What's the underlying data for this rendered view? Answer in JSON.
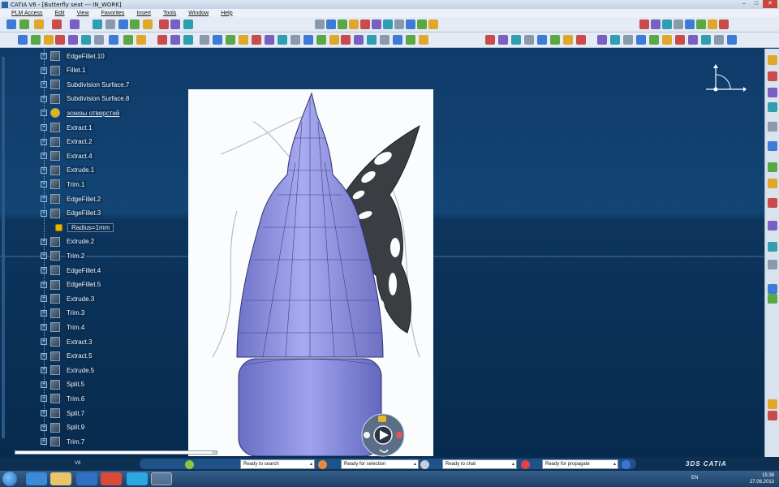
{
  "window": {
    "title": "CATIA V6 - [Butterfly seat --- IN_WORK]",
    "controls": [
      "–",
      "□",
      "✕"
    ]
  },
  "menu": [
    "PLM Access",
    "Edit",
    "View",
    "Favorites",
    "Insert",
    "Tools",
    "Window",
    "Help"
  ],
  "tree": {
    "nodes": [
      {
        "label": "EdgeFillet.10",
        "kind": "op"
      },
      {
        "label": "Fillet.1",
        "kind": "op"
      },
      {
        "label": "Subdivision Surface.7",
        "kind": "op"
      },
      {
        "label": "Subdivision Surface.8",
        "kind": "op"
      },
      {
        "label": "эскизы отверстий",
        "kind": "group"
      },
      {
        "label": "Extract.1",
        "kind": "op"
      },
      {
        "label": "Extract.2",
        "kind": "op"
      },
      {
        "label": "Extract.4",
        "kind": "op"
      },
      {
        "label": "Extrude.1",
        "kind": "op"
      },
      {
        "label": "Trim.1",
        "kind": "op"
      },
      {
        "label": "EdgeFillet.2",
        "kind": "op"
      },
      {
        "label": "EdgeFillet.3",
        "kind": "op"
      },
      {
        "label": "Radius=1mm",
        "kind": "param"
      },
      {
        "label": "Extrude.2",
        "kind": "op"
      },
      {
        "label": "Trim.2",
        "kind": "op"
      },
      {
        "label": "EdgeFillet.4",
        "kind": "op"
      },
      {
        "label": "EdgeFillet.5",
        "kind": "op"
      },
      {
        "label": "Extrude.3",
        "kind": "op"
      },
      {
        "label": "Trim.3",
        "kind": "op"
      },
      {
        "label": "Trim.4",
        "kind": "op"
      },
      {
        "label": "Extract.3",
        "kind": "op"
      },
      {
        "label": "Extract.5",
        "kind": "op"
      },
      {
        "label": "Extrude.5",
        "kind": "op"
      },
      {
        "label": "Split.5",
        "kind": "op"
      },
      {
        "label": "Trim.6",
        "kind": "op"
      },
      {
        "label": "Split.7",
        "kind": "op"
      },
      {
        "label": "Split.9",
        "kind": "op"
      },
      {
        "label": "Trim.7",
        "kind": "op"
      }
    ]
  },
  "status": {
    "app_badge": "V6",
    "fields": [
      "Ready to search",
      "Ready for selection",
      "Ready to chat",
      "Ready for propagate"
    ],
    "brand": "3DS CATIA"
  },
  "taskbar": {
    "lang": "EN",
    "time": "15:38",
    "date": "27.06.2013"
  },
  "colors": {
    "seat_fill": "#8f93e0",
    "wing_fill": "#3a3d42",
    "background_top": "#134574",
    "background_bottom": "#072b4e"
  }
}
